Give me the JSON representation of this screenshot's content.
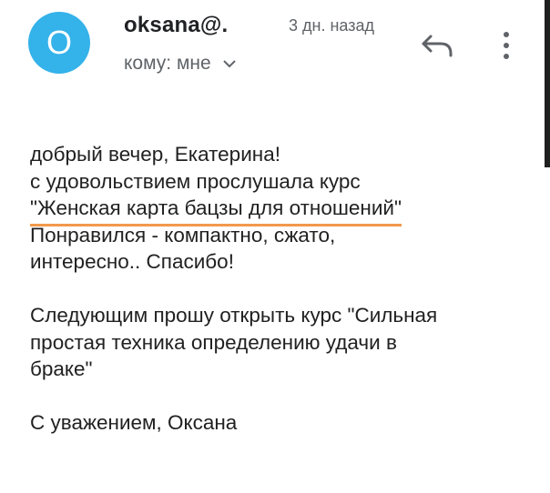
{
  "header": {
    "avatar_letter": "O",
    "sender": "oksana@.",
    "time": "3 дн. назад",
    "recipient": "кому: мне"
  },
  "icons": {
    "reply": "reply-icon",
    "more": "more-vert-icon",
    "chevron": "chevron-down-icon"
  },
  "colors": {
    "avatar": "#34b2ea",
    "highlight_underline": "#f2994a"
  },
  "message": {
    "greeting": "добрый вечер, Екатерина!",
    "line2": "с удовольствием прослушала курс",
    "course_title": "\"Женская карта бацзы для отношений\"",
    "line4": "Понравился - компактно, сжато,",
    "line5": "интересно.. Спасибо!",
    "line6": "Следующим прошу открыть курс  \"Сильная",
    "line7": "простая техника определению удачи в",
    "line8": "браке\"",
    "signature": "С уважением, Оксана"
  }
}
